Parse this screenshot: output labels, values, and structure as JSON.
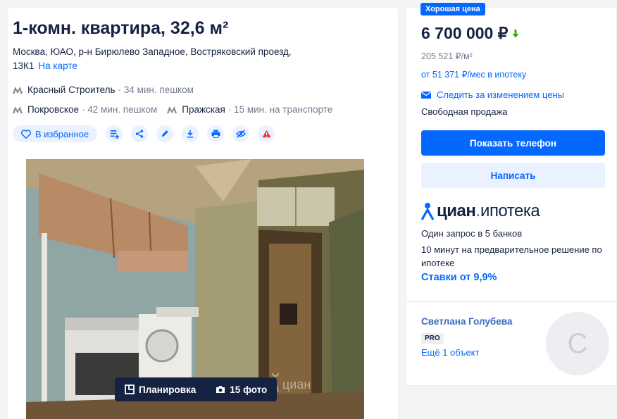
{
  "listing": {
    "title": "1-комн. квартира, 32,6 м²",
    "address": "Москва, ЮАО, р-н Бирюлево Западное, Востряковский проезд, 13К1",
    "map_link": "На карте",
    "metro": [
      {
        "station": "Красный Строитель",
        "time": "· 34 мин. пешком"
      },
      {
        "station": "Покровское",
        "time": "· 42 мин. пешком"
      },
      {
        "station": "Пражская",
        "time": "· 15 мин. на транспорте"
      }
    ],
    "favorite_label": "В избранное",
    "photo_bar": {
      "layout_label": "Планировка",
      "photos_label": "15 фото"
    },
    "watermark": "циан"
  },
  "sidebar": {
    "badge": "Хорошая цена",
    "price": "6 700 000 ₽",
    "price_per_m": "205 521 ₽/м²",
    "mortgage": "от 51 371 ₽/мес в ипотеку",
    "follow": "Следить за изменением цены",
    "sale_type": "Свободная продажа",
    "show_phone": "Показать телефон",
    "write": "Написать",
    "mortgage_promo": {
      "brand": "циан",
      "brand_suffix": "ипотека",
      "line1": "Один запрос в 5 банков",
      "line2": "10 минут на предварительное решение по ипотеке",
      "rates": "Ставки от 9,9%"
    },
    "agent": {
      "name": "Светлана Голубева",
      "badge": "PRO",
      "objects": "Ещё 1 объект",
      "avatar_letter": "С"
    }
  },
  "colors": {
    "accent": "#0468ff",
    "metro": "#8c8c8c",
    "text": "#152242",
    "muted": "#737a8e",
    "price_down": "#34ac0a"
  }
}
